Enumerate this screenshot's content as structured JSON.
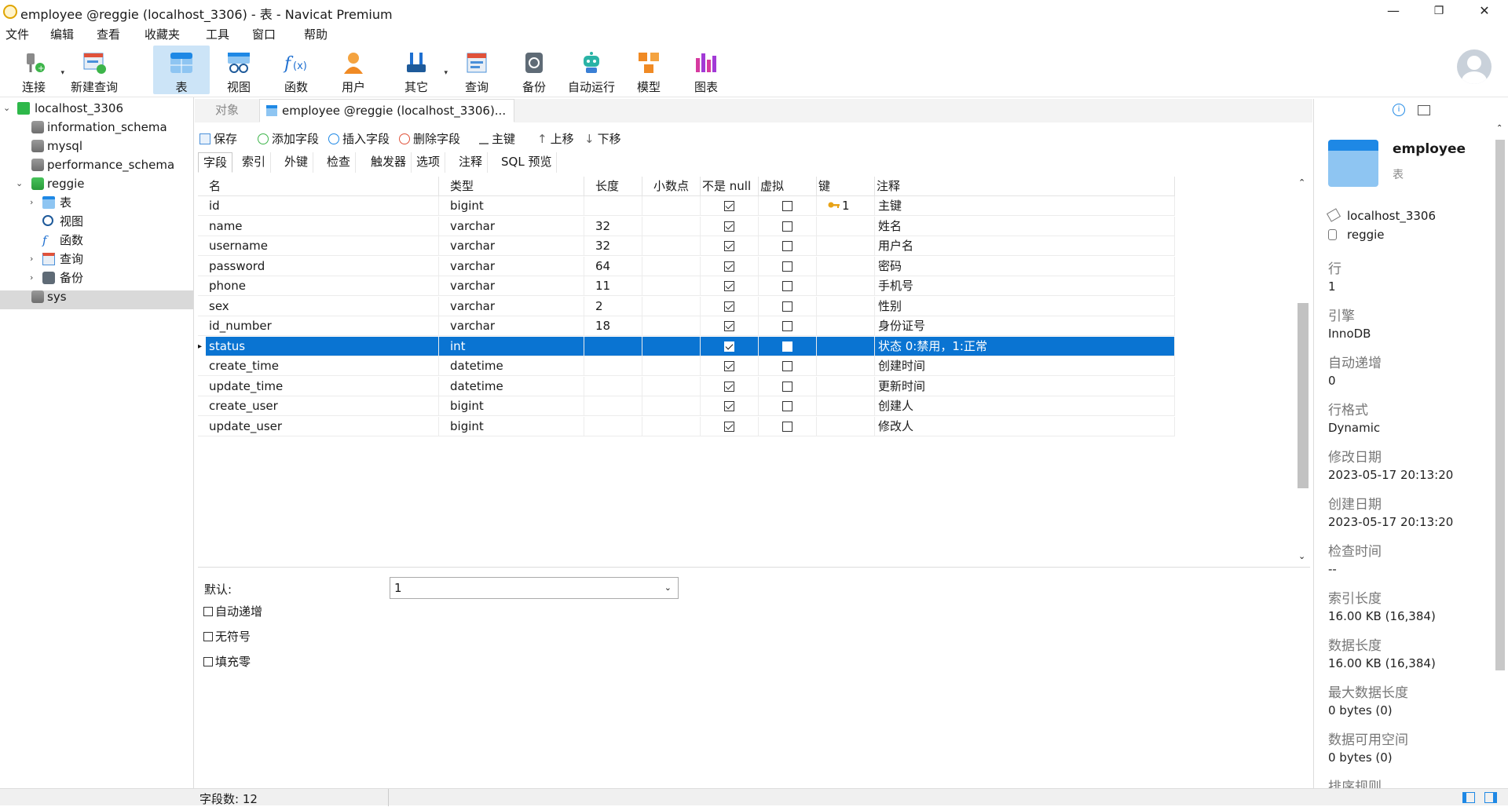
{
  "window": {
    "title": "employee @reggie (localhost_3306) - 表 - Navicat Premium",
    "min": "—",
    "restore": "❐",
    "close": "✕"
  },
  "menu": [
    "文件",
    "编辑",
    "查看",
    "收藏夹",
    "工具",
    "窗口",
    "帮助"
  ],
  "toolbar": {
    "items": [
      "连接",
      "新建查询",
      "表",
      "视图",
      "函数",
      "用户",
      "其它",
      "查询",
      "备份",
      "自动运行",
      "模型",
      "图表"
    ]
  },
  "tree": {
    "connection": "localhost_3306",
    "databases": [
      "information_schema",
      "mysql",
      "performance_schema",
      "reggie"
    ],
    "reggie_children": [
      "表",
      "视图",
      "函数",
      "查询",
      "备份"
    ],
    "last": "sys"
  },
  "tabs": {
    "objects": "对象",
    "active": "employee @reggie (localhost_3306)..."
  },
  "objbar": {
    "save": "保存",
    "add_field": "添加字段",
    "insert_field": "插入字段",
    "delete_field": "删除字段",
    "primary_key": "主键",
    "move_up": "上移",
    "move_down": "下移"
  },
  "subtabs": [
    "字段",
    "索引",
    "外键",
    "检查",
    "触发器",
    "选项",
    "注释",
    "SQL 预览"
  ],
  "grid": {
    "headers": [
      "名",
      "类型",
      "长度",
      "小数点",
      "不是 null",
      "虚拟",
      "键",
      "注释"
    ],
    "rows": [
      {
        "name": "id",
        "type": "bigint",
        "length": "",
        "decimals": "",
        "not_null": true,
        "virtual": false,
        "key": "1",
        "comment": "主键"
      },
      {
        "name": "name",
        "type": "varchar",
        "length": "32",
        "decimals": "",
        "not_null": true,
        "virtual": false,
        "key": "",
        "comment": "姓名"
      },
      {
        "name": "username",
        "type": "varchar",
        "length": "32",
        "decimals": "",
        "not_null": true,
        "virtual": false,
        "key": "",
        "comment": "用户名"
      },
      {
        "name": "password",
        "type": "varchar",
        "length": "64",
        "decimals": "",
        "not_null": true,
        "virtual": false,
        "key": "",
        "comment": "密码"
      },
      {
        "name": "phone",
        "type": "varchar",
        "length": "11",
        "decimals": "",
        "not_null": true,
        "virtual": false,
        "key": "",
        "comment": "手机号"
      },
      {
        "name": "sex",
        "type": "varchar",
        "length": "2",
        "decimals": "",
        "not_null": true,
        "virtual": false,
        "key": "",
        "comment": "性别"
      },
      {
        "name": "id_number",
        "type": "varchar",
        "length": "18",
        "decimals": "",
        "not_null": true,
        "virtual": false,
        "key": "",
        "comment": "身份证号"
      },
      {
        "name": "status",
        "type": "int",
        "length": "",
        "decimals": "",
        "not_null": true,
        "virtual": false,
        "key": "",
        "comment": "状态 0:禁用，1:正常"
      },
      {
        "name": "create_time",
        "type": "datetime",
        "length": "",
        "decimals": "",
        "not_null": true,
        "virtual": false,
        "key": "",
        "comment": "创建时间"
      },
      {
        "name": "update_time",
        "type": "datetime",
        "length": "",
        "decimals": "",
        "not_null": true,
        "virtual": false,
        "key": "",
        "comment": "更新时间"
      },
      {
        "name": "create_user",
        "type": "bigint",
        "length": "",
        "decimals": "",
        "not_null": true,
        "virtual": false,
        "key": "",
        "comment": "创建人"
      },
      {
        "name": "update_user",
        "type": "bigint",
        "length": "",
        "decimals": "",
        "not_null": true,
        "virtual": false,
        "key": "",
        "comment": "修改人"
      }
    ],
    "selected_row": "status"
  },
  "props": {
    "default_label": "默认:",
    "default_value": "1",
    "auto_increment": "自动递增",
    "unsigned": "无符号",
    "zerofill": "填充零"
  },
  "status": {
    "field_count": "字段数: 12"
  },
  "info": {
    "name": "employee",
    "kind": "表",
    "connection": "localhost_3306",
    "database": "reggie",
    "fields": [
      {
        "label": "行",
        "value": "1"
      },
      {
        "label": "引擎",
        "value": "InnoDB"
      },
      {
        "label": "自动递增",
        "value": "0"
      },
      {
        "label": "行格式",
        "value": "Dynamic"
      },
      {
        "label": "修改日期",
        "value": "2023-05-17 20:13:20"
      },
      {
        "label": "创建日期",
        "value": "2023-05-17 20:13:20"
      },
      {
        "label": "检查时间",
        "value": "--"
      },
      {
        "label": "索引长度",
        "value": "16.00 KB (16,384)"
      },
      {
        "label": "数据长度",
        "value": "16.00 KB (16,384)"
      },
      {
        "label": "最大数据长度",
        "value": "0 bytes (0)"
      },
      {
        "label": "数据可用空间",
        "value": "0 bytes (0)"
      },
      {
        "label": "排序规则",
        "value": ""
      }
    ]
  },
  "colors": {
    "selection": "#0a74d2",
    "active_toolbar": "#cce4f7",
    "accent": "#1e88e5"
  }
}
